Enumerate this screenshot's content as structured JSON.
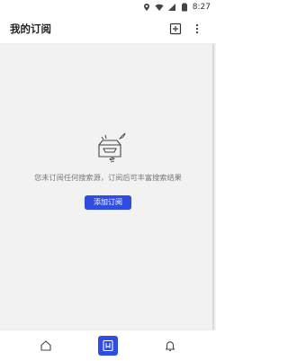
{
  "status_bar": {
    "time": "8:27"
  },
  "app_bar": {
    "title": "我的订阅"
  },
  "empty_state": {
    "message": "您未订阅任何搜索源，订阅后可丰富搜索结果",
    "button_label": "添加订阅"
  },
  "bottom_nav": {
    "items": [
      {
        "icon": "home-icon",
        "active": false
      },
      {
        "icon": "subscription-icon",
        "active": true
      },
      {
        "icon": "bell-icon",
        "active": false
      }
    ]
  },
  "colors": {
    "accent": "#2f4de0",
    "background": "#f2f2f2",
    "text_secondary": "#777777"
  }
}
